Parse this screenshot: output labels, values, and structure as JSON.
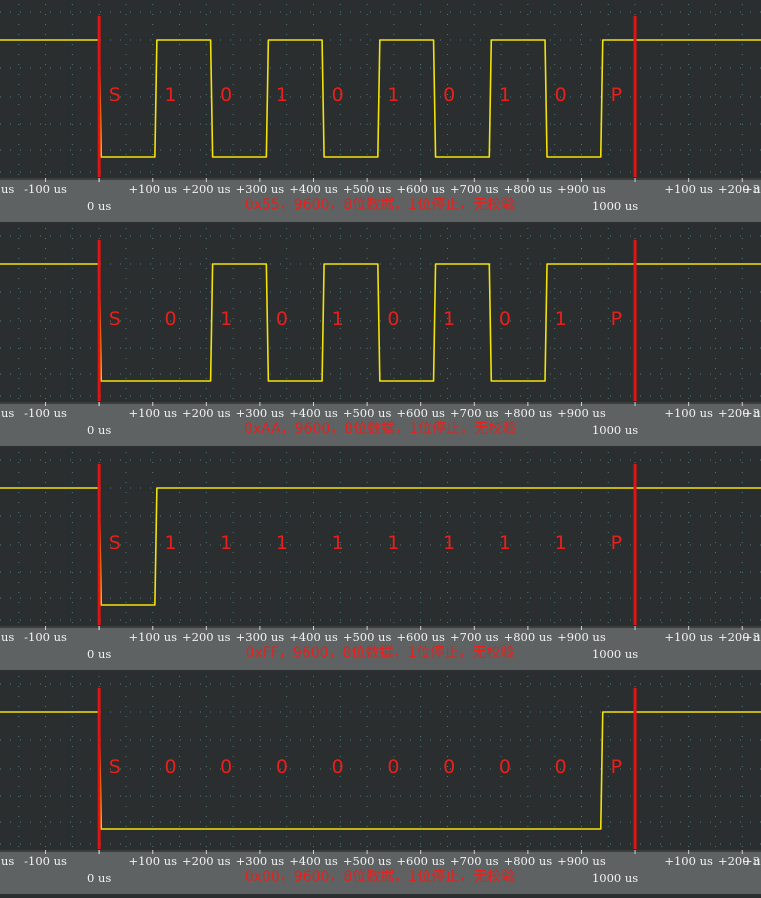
{
  "colors": {
    "plot_bg": "#2a2e2e",
    "axis_band": "#5e6262",
    "grid": "#4d7a7e",
    "signal": "#f2e20a",
    "marker": "#e01414",
    "bit_label": "#e8201c",
    "tick_text": "#f2f2f2"
  },
  "axis": {
    "xlim": [
      -185,
      1235
    ],
    "zero_label": "0 us",
    "end_label": "1000 us",
    "tick_labels": [
      {
        "x": -100,
        "text": "-100 us"
      },
      {
        "x": 100,
        "text": "+100 us"
      },
      {
        "x": 200,
        "text": "+200 us"
      },
      {
        "x": 300,
        "text": "+300 us"
      },
      {
        "x": 400,
        "text": "+400 us"
      },
      {
        "x": 500,
        "text": "+500 us"
      },
      {
        "x": 600,
        "text": "+600 us"
      },
      {
        "x": 700,
        "text": "+700 us"
      },
      {
        "x": 800,
        "text": "+800 us"
      },
      {
        "x": 900,
        "text": "+900 us"
      },
      {
        "x": 1100,
        "text": "+100 us"
      },
      {
        "x": 1200,
        "text": "+200 us"
      }
    ],
    "left_edge_text": "us",
    "right_edge_text": "+3"
  },
  "chart_data": [
    {
      "type": "line",
      "caption": "0x55，9600，8位数据，1位停止，无校验",
      "bit_labels": [
        "S",
        "1",
        "0",
        "1",
        "0",
        "1",
        "0",
        "1",
        "0",
        "P"
      ],
      "bit_period_us": 104,
      "markers_us": [
        0,
        1000
      ],
      "levels": [
        0,
        1,
        0,
        1,
        0,
        1,
        0,
        1,
        0,
        1
      ]
    },
    {
      "type": "line",
      "caption": "0xAA，9600，8位数据，1位停止，无校验",
      "bit_labels": [
        "S",
        "0",
        "1",
        "0",
        "1",
        "0",
        "1",
        "0",
        "1",
        "P"
      ],
      "bit_period_us": 104,
      "markers_us": [
        0,
        1000
      ],
      "levels": [
        0,
        0,
        1,
        0,
        1,
        0,
        1,
        0,
        1,
        1
      ]
    },
    {
      "type": "line",
      "caption": "0xFF，9600，8位数据，1位停止，无校验",
      "bit_labels": [
        "S",
        "1",
        "1",
        "1",
        "1",
        "1",
        "1",
        "1",
        "1",
        "P"
      ],
      "bit_period_us": 104,
      "markers_us": [
        0,
        1000
      ],
      "levels": [
        0,
        1,
        1,
        1,
        1,
        1,
        1,
        1,
        1,
        1
      ]
    },
    {
      "type": "line",
      "caption": "0x00，9600，8位数据，1位停止，无校验",
      "bit_labels": [
        "S",
        "0",
        "0",
        "0",
        "0",
        "0",
        "0",
        "0",
        "0",
        "P"
      ],
      "bit_period_us": 104,
      "markers_us": [
        0,
        1000
      ],
      "levels": [
        0,
        0,
        0,
        0,
        0,
        0,
        0,
        0,
        0,
        1
      ]
    }
  ]
}
